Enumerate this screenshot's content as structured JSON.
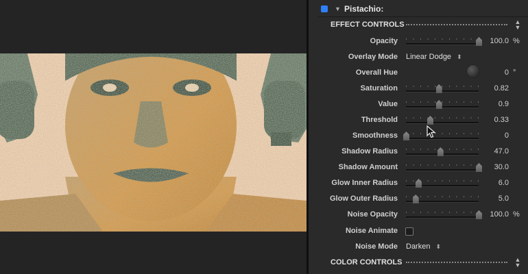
{
  "header": {
    "title": "Pistachio:"
  },
  "sections": {
    "effect_controls": "EFFECT CONTROLS",
    "color_controls": "COLOR CONTROLS"
  },
  "params": {
    "opacity": {
      "label": "Opacity",
      "value": "100.0",
      "unit": "%",
      "level": 1.0
    },
    "overlay_mode": {
      "label": "Overlay Mode",
      "value": "Linear Dodge"
    },
    "overall_hue": {
      "label": "Overall Hue",
      "value": "0",
      "unit": "°"
    },
    "saturation": {
      "label": "Saturation",
      "value": "0.82",
      "level": 0.45
    },
    "value": {
      "label": "Value",
      "value": "0.9",
      "level": 0.45
    },
    "threshold": {
      "label": "Threshold",
      "value": "0.33",
      "level": 0.33
    },
    "smoothness": {
      "label": "Smoothness",
      "value": "0",
      "level": 0.0
    },
    "shadow_radius": {
      "label": "Shadow Radius",
      "value": "47.0",
      "level": 0.47
    },
    "shadow_amount": {
      "label": "Shadow Amount",
      "value": "30.0",
      "level": 1.0
    },
    "glow_inner_radius": {
      "label": "Glow Inner Radius",
      "value": "6.0",
      "level": 0.17
    },
    "glow_outer_radius": {
      "label": "Glow Outer Radius",
      "value": "5.0",
      "level": 0.13
    },
    "noise_opacity": {
      "label": "Noise Opacity",
      "value": "100.0",
      "unit": "%",
      "level": 1.0
    },
    "noise_animate": {
      "label": "Noise Animate",
      "checked": false
    },
    "noise_mode": {
      "label": "Noise Mode",
      "value": "Darken"
    }
  },
  "icons": {
    "expand": "disclosure-triangle-icon",
    "stepper": "up-down-arrows-icon",
    "cursor": "mouse-pointer-icon"
  },
  "colors": {
    "accent": "#2f7ff5",
    "panel": "#2a2a2a",
    "image_tint_light": "#f3cfae",
    "image_tint_dark": "#6f7e6c",
    "image_tint_orange": "#d79a4a"
  }
}
